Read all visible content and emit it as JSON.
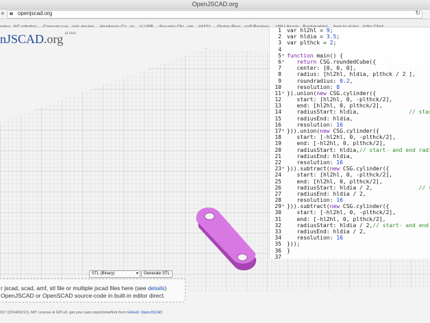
{
  "window": {
    "title": "OpenJSCAD.org"
  },
  "browser": {
    "url": "openjscad.org",
    "bookmarks": [
      "entur...NC robotics",
      "Concept sup...axis design",
      "Hardware Co...ns – V-USB",
      "Sesame Chi...om – 44321",
      "Gluten-Free...ss® Recipes",
      "UW Librarie...Bookmarklet",
      "how to make...d the Chef"
    ]
  },
  "logo": {
    "main": "nJSCAD",
    "tld": ".org",
    "tag": "ALPHA"
  },
  "editor": {
    "lines": [
      [
        {
          "t": "var hl2hl = "
        },
        {
          "t": "9",
          "c": "num"
        },
        {
          "t": ";"
        }
      ],
      [
        {
          "t": "var hldia = "
        },
        {
          "t": "3.5",
          "c": "num"
        },
        {
          "t": ";"
        }
      ],
      [
        {
          "t": "var plthck = "
        },
        {
          "t": "2",
          "c": "num"
        },
        {
          "t": ";"
        }
      ],
      [],
      [
        {
          "t": "function ",
          "c": "kw"
        },
        {
          "t": "main() {"
        }
      ],
      [
        {
          "t": "   "
        },
        {
          "t": "return ",
          "c": "kw"
        },
        {
          "t": "CSG.roundedCube({"
        }
      ],
      [
        {
          "t": "   center: [0, 0, 0],"
        }
      ],
      [
        {
          "t": "   radius: [hl2hl, hldia, plthck / 2 ],"
        }
      ],
      [
        {
          "t": "   roundradius: "
        },
        {
          "t": "0.2",
          "c": "num"
        },
        {
          "t": ","
        }
      ],
      [
        {
          "t": "   resolution: "
        },
        {
          "t": "8",
          "c": "num"
        }
      ],
      [
        {
          "t": "}).union("
        },
        {
          "t": "new ",
          "c": "kw"
        },
        {
          "t": "CSG.cylinder({"
        }
      ],
      [
        {
          "t": "   start: [hl2hl, 0, -plthck/2],"
        }
      ],
      [
        {
          "t": "   end: [hl2hl, 0, plthck/2],"
        }
      ],
      [
        {
          "t": "   radiusStart: hldia,               "
        },
        {
          "t": "// start-",
          "c": "cm"
        }
      ],
      [
        {
          "t": "   radiusEnd: hldia,"
        }
      ],
      [
        {
          "t": "   resolution: "
        },
        {
          "t": "16",
          "c": "num"
        }
      ],
      [
        {
          "t": "})).union("
        },
        {
          "t": "new ",
          "c": "kw"
        },
        {
          "t": "CSG.cylinder({"
        }
      ],
      [
        {
          "t": "   start: [-hl2hl, 0, -plthck/2],"
        }
      ],
      [
        {
          "t": "   end: [-hl2hl, 0, plthck/2],"
        }
      ],
      [
        {
          "t": "   radiusStart: hldia,"
        },
        {
          "t": "// start- and end radius defi",
          "c": "cm"
        }
      ],
      [
        {
          "t": "   radiusEnd: hldia,"
        }
      ],
      [
        {
          "t": "   resolution: "
        },
        {
          "t": "16",
          "c": "num"
        }
      ],
      [
        {
          "t": "})).subtract("
        },
        {
          "t": "new ",
          "c": "kw"
        },
        {
          "t": "CSG.cylinder({"
        }
      ],
      [
        {
          "t": "   start: [hl2hl, 0, -plthck/2],"
        }
      ],
      [
        {
          "t": "   end: [hl2hl, 0, plthck/2],"
        }
      ],
      [
        {
          "t": "   radiusStart: hldia / 2,              "
        },
        {
          "t": "// st",
          "c": "cm"
        }
      ],
      [
        {
          "t": "   radiusEnd: hldia / 2,"
        }
      ],
      [
        {
          "t": "   resolution: "
        },
        {
          "t": "16",
          "c": "num"
        }
      ],
      [
        {
          "t": "})).subtract("
        },
        {
          "t": "new ",
          "c": "kw"
        },
        {
          "t": "CSG.cylinder({"
        }
      ],
      [
        {
          "t": "   start: [-hl2hl, 0, -plthck/2],"
        }
      ],
      [
        {
          "t": "   end: [-hl2hl, 0, plthck/2],"
        }
      ],
      [
        {
          "t": "   radiusStart: hldia / 2,"
        },
        {
          "t": "// start- and end radius",
          "c": "cm"
        }
      ],
      [
        {
          "t": "   radiusEnd: hldia / 2,"
        }
      ],
      [
        {
          "t": "   resolution: "
        },
        {
          "t": "16",
          "c": "num"
        }
      ],
      [
        {
          "t": "}));"
        }
      ],
      [
        {
          "t": "}"
        }
      ],
      []
    ],
    "folds": [
      "5",
      "6",
      "11",
      "17",
      "23",
      "29"
    ]
  },
  "controls": {
    "format": "STL (Binary)",
    "generate": "Generate STL"
  },
  "dropzone": {
    "line1_pre": "r jscad, scad, amf, stl file or multiple jscad files here (see ",
    "line1_link": "details",
    "line1_post": ")",
    "line2": "OpenJSCAD or OpenSCAD source-code in built-in editor direct."
  },
  "footer": {
    "text": "017 (2014/02/12), MIT License & GPLv2, get your own copy/clone/fork from ",
    "link": "GitHub: OpenJSCAD"
  },
  "colors": {
    "model": "#d878e2",
    "model_dark": "#a544b2",
    "keyword": "#7a1fa2",
    "number": "#1a3fd1",
    "comment": "#2f8f2f",
    "link": "#1e4fb0"
  }
}
